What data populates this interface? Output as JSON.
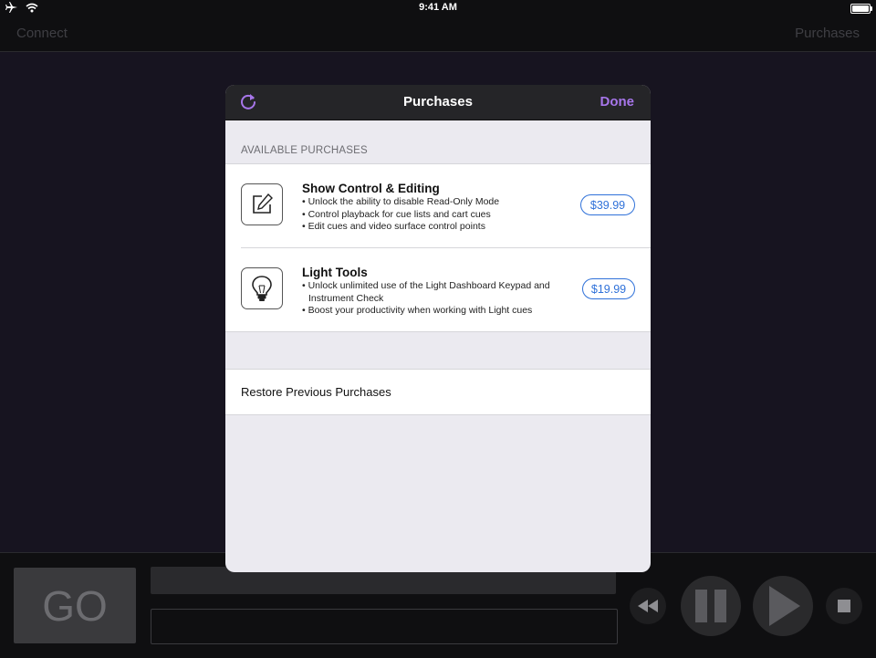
{
  "status_bar": {
    "time": "9:41 AM"
  },
  "nav": {
    "left_label": "Connect",
    "right_label": "Purchases"
  },
  "controls": {
    "go_label": "GO"
  },
  "modal": {
    "title": "Purchases",
    "done_label": "Done",
    "section_header": "AVAILABLE PURCHASES",
    "items": [
      {
        "title": "Show Control & Editing",
        "icon": "edit-icon",
        "bullets": [
          "• Unlock the ability to disable Read-Only Mode",
          "• Control playback for cue lists and cart cues",
          "• Edit cues and video surface control points"
        ],
        "price": "$39.99"
      },
      {
        "title": "Light Tools",
        "icon": "lightbulb-icon",
        "bullets": [
          "• Unlock unlimited use of the Light Dashboard Keypad and",
          "Instrument Check",
          "• Boost your productivity when working with Light cues"
        ],
        "price": "$19.99"
      }
    ],
    "restore_label": "Restore Previous Purchases"
  },
  "colors": {
    "accent": "#a776ea",
    "price_blue": "#2f71d9",
    "background": "#171420"
  }
}
